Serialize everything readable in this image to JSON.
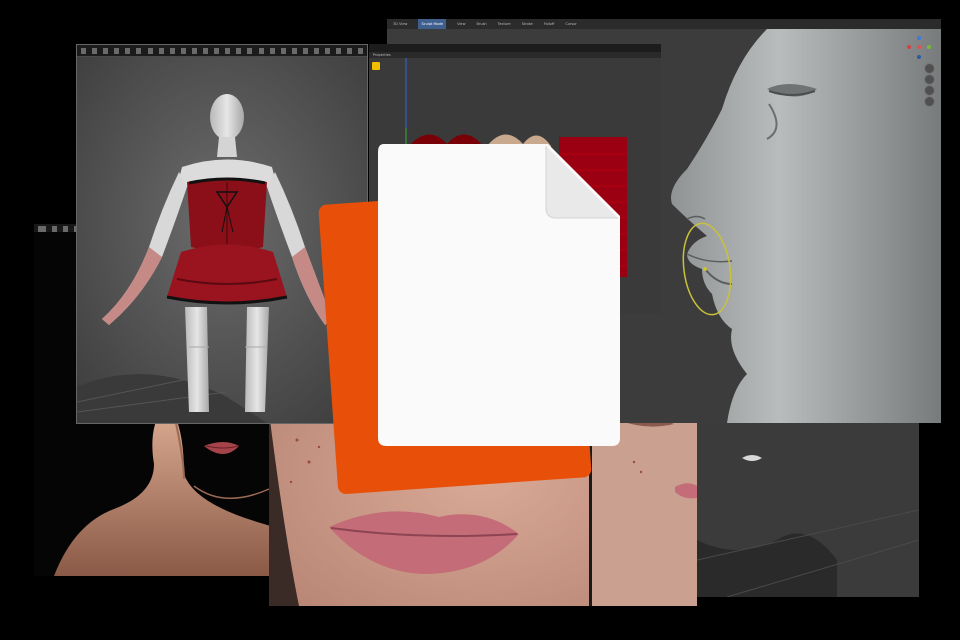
{
  "sculpt_window": {
    "header_tabs": [
      {
        "label": "3D View",
        "active": false
      },
      {
        "label": "Sculpt Mode",
        "active": true
      },
      {
        "label": "View",
        "active": false
      },
      {
        "label": "Brush",
        "active": false
      },
      {
        "label": "Texture",
        "active": false
      },
      {
        "label": "Stroke",
        "active": false
      },
      {
        "label": "Falloff",
        "active": false
      },
      {
        "label": "Cursor",
        "active": false
      }
    ]
  },
  "texture_window": {
    "panel_title": "Properties",
    "swatch_colors": [
      "#7a0008",
      "#b50010"
    ]
  },
  "colors": {
    "file_page": "#fafafa",
    "file_card_accent": "#e8500a",
    "dress": "#8a0f18",
    "selection_ring": "#c9c23a"
  },
  "file_icon": "document-file-icon"
}
